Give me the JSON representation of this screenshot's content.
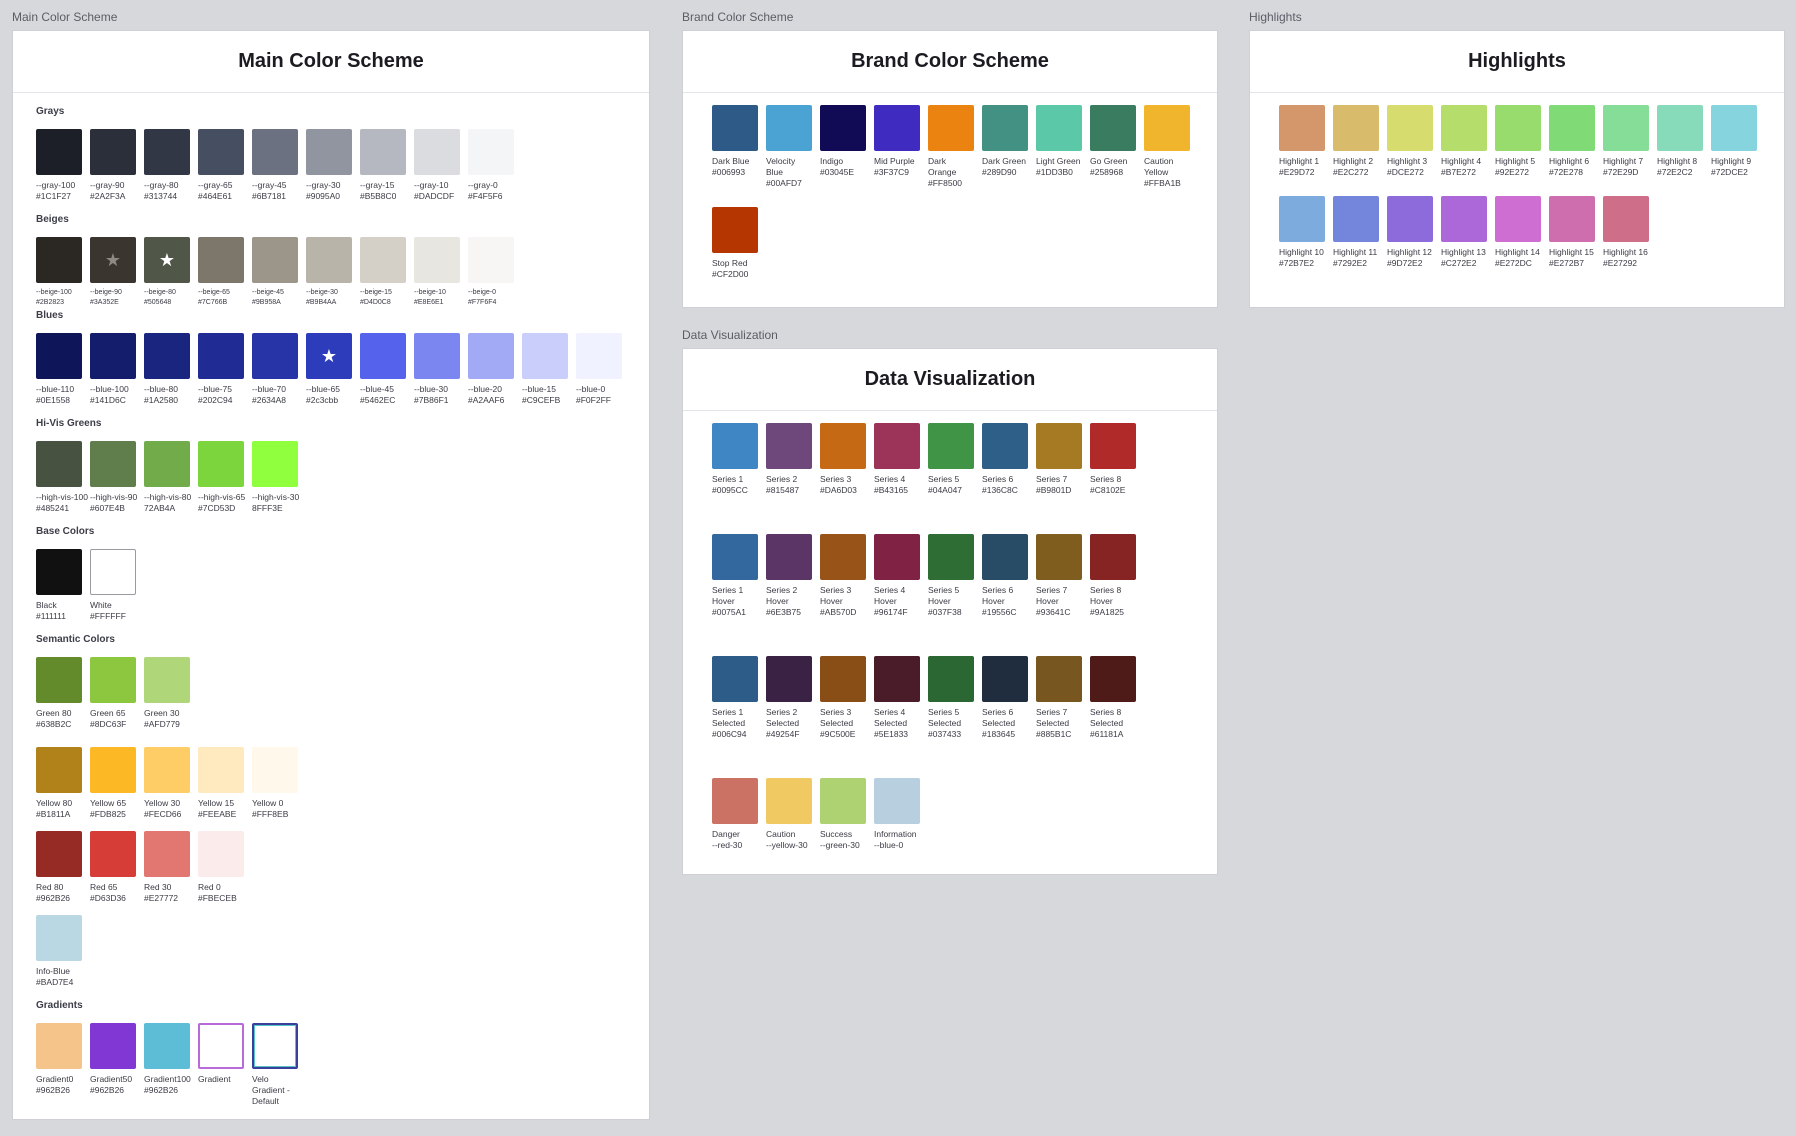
{
  "frames": {
    "main": {
      "label": "Main Color Scheme",
      "title": "Main Color Scheme"
    },
    "brand": {
      "label": "Brand Color Scheme",
      "title": "Brand Color Scheme"
    },
    "highlights": {
      "label": "Highlights",
      "title": "Highlights"
    },
    "dataviz": {
      "label": "Data Visualization",
      "title": "Data Visualization"
    }
  },
  "main": {
    "grays": {
      "title": "Grays",
      "items": [
        {
          "label": "--gray-100\n#1C1F27",
          "color": "#1C1F27"
        },
        {
          "label": "--gray-90\n#2A2F3A",
          "color": "#2A2F3A"
        },
        {
          "label": "--gray-80\n#313744",
          "color": "#313744"
        },
        {
          "label": "--gray-65\n#464E61",
          "color": "#464E61"
        },
        {
          "label": "--gray-45\n#6B7181",
          "color": "#6B7181"
        },
        {
          "label": "--gray-30\n#9095A0",
          "color": "#9095A0"
        },
        {
          "label": "--gray-15\n#B5B8C0",
          "color": "#B5B8C0"
        },
        {
          "label": "--gray-10\n#DADCDF",
          "color": "#DADCDF"
        },
        {
          "label": "--gray-0\n#F4F5F6",
          "color": "#F4F5F6"
        }
      ]
    },
    "beiges": {
      "title": "Beiges",
      "items": [
        {
          "label": "--beige-100\n#2B2823",
          "color": "#2B2823"
        },
        {
          "label": "--beige-90\n#3A352E",
          "color": "#3A352E",
          "star": "★",
          "star_color": "#8d8a85"
        },
        {
          "label": "--beige-80\n#505648",
          "color": "#505648",
          "star": "★",
          "star_color": "#ffffff"
        },
        {
          "label": "--beige-65\n#7C766B",
          "color": "#7C766B"
        },
        {
          "label": "--beige-45\n#9B958A",
          "color": "#9B958A"
        },
        {
          "label": "--beige-30\n#B9B4AA",
          "color": "#B9B4AA"
        },
        {
          "label": "--beige-15\n#D4D0C8",
          "color": "#D4D0C8"
        },
        {
          "label": "--beige-10\n#E8E6E1",
          "color": "#E8E6E1"
        },
        {
          "label": "--beige-0\n#F7F6F4",
          "color": "#F7F6F4"
        }
      ]
    },
    "blues": {
      "title": "Blues",
      "items": [
        {
          "label": "--blue-110\n#0E1558",
          "color": "#0E1558"
        },
        {
          "label": "--blue-100\n#141D6C",
          "color": "#141D6C"
        },
        {
          "label": "--blue-80\n#1A2580",
          "color": "#1A2580"
        },
        {
          "label": "--blue-75\n#202C94",
          "color": "#202C94"
        },
        {
          "label": "--blue-70\n#2634A8",
          "color": "#2634A8"
        },
        {
          "label": "--blue-65\n#2c3cbb",
          "color": "#2c3cbb",
          "star": "★",
          "star_color": "#ffffff"
        },
        {
          "label": "--blue-45\n#5462EC",
          "color": "#5462EC"
        },
        {
          "label": "--blue-30\n#7B86F1",
          "color": "#7B86F1"
        },
        {
          "label": "--blue-20\n#A2AAF6",
          "color": "#A2AAF6"
        },
        {
          "label": "--blue-15\n#C9CEFB",
          "color": "#C9CEFB"
        },
        {
          "label": "--blue-0\n#F0F2FF",
          "color": "#F0F2FF"
        }
      ]
    },
    "greens": {
      "title": "Hi-Vis Greens",
      "items": [
        {
          "label": "--high-vis-100\n#485241",
          "color": "#485241"
        },
        {
          "label": "--high-vis-90\n#607E4B",
          "color": "#607E4B"
        },
        {
          "label": "--high-vis-80\n72AB4A",
          "color": "#72AB4A"
        },
        {
          "label": "--high-vis-65\n#7CD53D",
          "color": "#7CD53D"
        },
        {
          "label": "--high-vis-30\n8FFF3E",
          "color": "#8FFF3E"
        }
      ]
    },
    "base": {
      "title": "Base Colors",
      "items": [
        {
          "label": "Black\n#111111",
          "color": "#111111"
        },
        {
          "label": "White\n#FFFFFF",
          "color": "#FFFFFF"
        }
      ]
    },
    "semantic": {
      "title": "Semantic Colors",
      "green": [
        {
          "label": "Green 80\n#638B2C",
          "color": "#638B2C"
        },
        {
          "label": "Green 65\n#8DC63F",
          "color": "#8DC63F"
        },
        {
          "label": "Green 30\n#AFD779",
          "color": "#AFD779"
        }
      ],
      "yellow": [
        {
          "label": "Yellow 80\n#B1811A",
          "color": "#B1811A"
        },
        {
          "label": "Yellow 65\n#FDB825",
          "color": "#FDB825"
        },
        {
          "label": "Yellow 30\n#FECD66",
          "color": "#FECD66"
        },
        {
          "label": "Yellow 15\n#FEEABE",
          "color": "#FEEABE"
        },
        {
          "label": "Yellow 0\n#FFF8EB",
          "color": "#FFF8EB"
        }
      ],
      "red": [
        {
          "label": "Red  80\n#962B26",
          "color": "#962B26"
        },
        {
          "label": "Red 65\n#D63D36",
          "color": "#D63D36"
        },
        {
          "label": "Red 30\n#E27772",
          "color": "#E27772"
        },
        {
          "label": "Red 0\n#FBECEB",
          "color": "#FBECEB"
        }
      ],
      "info": [
        {
          "label": "Info-Blue\n#BAD7E4",
          "color": "#BAD7E4"
        }
      ]
    },
    "gradients": {
      "title": "Gradients",
      "items": [
        {
          "label": "Gradient0\n#962B26",
          "color": "#F4C48A"
        },
        {
          "label": "Gradient50\n#962B26",
          "color": "#8137D3"
        },
        {
          "label": "Gradient100\n#962B26",
          "color": "#5DBCD6"
        },
        {
          "label": "Gradient",
          "color": "#FFFFFF"
        },
        {
          "label": "Velo\nGradient -\nDefault",
          "color": "#FFFFFF"
        }
      ]
    }
  },
  "brand": [
    {
      "label": "Dark Blue\n#006993",
      "color": "#2E5A87"
    },
    {
      "label": "Velocity\nBlue\n#00AFD7",
      "color": "#4BA3D4"
    },
    {
      "label": "Indigo\n#03045E",
      "color": "#110A55"
    },
    {
      "label": "Mid Purple\n#3F37C9",
      "color": "#3F2BC0"
    },
    {
      "label": "Dark\nOrange\n#FF8500",
      "color": "#EB8311"
    },
    {
      "label": "Dark Green\n#289D90",
      "color": "#429183"
    },
    {
      "label": "Light Green\n#1DD3B0",
      "color": "#5BC8A7"
    },
    {
      "label": "Go Green\n#258968",
      "color": "#3A7C60"
    },
    {
      "label": "Caution\nYellow\n#FFBA1B",
      "color": "#F0B52C"
    },
    {
      "label": "Stop Red\n#CF2D00",
      "color": "#B63602"
    }
  ],
  "highlights": [
    {
      "label": "Highlight 1\n#E29D72",
      "color": "#D4976C"
    },
    {
      "label": "Highlight 2\n#E2C272",
      "color": "#D8BC6C"
    },
    {
      "label": "Highlight 3\n#DCE272",
      "color": "#D6DD6E"
    },
    {
      "label": "Highlight 4\n#B7E272",
      "color": "#B5DD6C"
    },
    {
      "label": "Highlight 5\n#92E272",
      "color": "#97DC6C"
    },
    {
      "label": "Highlight 6\n#72E278",
      "color": "#80DB77"
    },
    {
      "label": "Highlight 7\n#72E29D",
      "color": "#85DD97"
    },
    {
      "label": "Highlight 8\n#72E2C2",
      "color": "#88DBBA"
    },
    {
      "label": "Highlight 9\n#72DCE2",
      "color": "#86D4DE"
    },
    {
      "label": "Highlight 10\n#72B7E2",
      "color": "#7DABDE"
    },
    {
      "label": "Highlight 11\n#7292E2",
      "color": "#7485DC"
    },
    {
      "label": "Highlight 12\n#9D72E2",
      "color": "#8D6BDA"
    },
    {
      "label": "Highlight 13\n#C272E2",
      "color": "#AC68D9"
    },
    {
      "label": "Highlight 14\n#E272DC",
      "color": "#CE6ED3"
    },
    {
      "label": "Highlight 15\n#E272B7",
      "color": "#CE6EAE"
    },
    {
      "label": "Highlight 16\n#E27292",
      "color": "#CE6E88"
    }
  ],
  "dataviz": {
    "series": [
      {
        "label": "Series 1\n#0095CC",
        "color": "#3F86C5"
      },
      {
        "label": "Series 2\n#815487",
        "color": "#6E487B"
      },
      {
        "label": "Series 3\n#DA6D03",
        "color": "#C56914"
      },
      {
        "label": "Series 4\n#B43165",
        "color": "#9B3458"
      },
      {
        "label": "Series 5\n#04A047",
        "color": "#3F9445"
      },
      {
        "label": "Series 6\n#136C8C",
        "color": "#2E5F88"
      },
      {
        "label": "Series 7\n#B9801D",
        "color": "#A67A22"
      },
      {
        "label": "Series 8\n#C8102E",
        "color": "#B02A2A"
      }
    ],
    "hover": [
      {
        "label": "Series 1\nHover\n#0075A1",
        "color": "#33689E"
      },
      {
        "label": "Series 2\nHover\n#6E3B75",
        "color": "#5C3567"
      },
      {
        "label": "Series 3\nHover\n#AB570D",
        "color": "#985418"
      },
      {
        "label": "Series 4\nHover\n#96174F",
        "color": "#802244"
      },
      {
        "label": "Series 5\nHover\n#037F38",
        "color": "#2E6E35"
      },
      {
        "label": "Series 6\nHover\n#19556C",
        "color": "#284B66"
      },
      {
        "label": "Series 7\nHover\n#93641C",
        "color": "#7E5D1F"
      },
      {
        "label": "Series 8\nHover\n#9A1825",
        "color": "#852422"
      }
    ],
    "selected": [
      {
        "label": "Series 1\nSelected\n#006C94",
        "color": "#2E5C88"
      },
      {
        "label": "Series 2\nSelected\n#49254F",
        "color": "#3A2245"
      },
      {
        "label": "Series 3\nSelected\n#9C500E",
        "color": "#884E16"
      },
      {
        "label": "Series 4\nSelected\n#5E1833",
        "color": "#4A1C2A"
      },
      {
        "label": "Series 5\nSelected\n#037433",
        "color": "#2B6733"
      },
      {
        "label": "Series 6\nSelected\n#183645",
        "color": "#1F2D3E"
      },
      {
        "label": "Series 7\nSelected\n#885B1C",
        "color": "#77561F"
      },
      {
        "label": "Series 8\nSelected\n#61181A",
        "color": "#4E1B19"
      }
    ],
    "status": [
      {
        "label": "Danger\n--red-30",
        "color": "#CB7265"
      },
      {
        "label": "Caution\n--yellow-30",
        "color": "#F1C962"
      },
      {
        "label": "Success\n--green-30",
        "color": "#AED172"
      },
      {
        "label": "Information\n--blue-0",
        "color": "#B8CFDF"
      }
    ]
  }
}
